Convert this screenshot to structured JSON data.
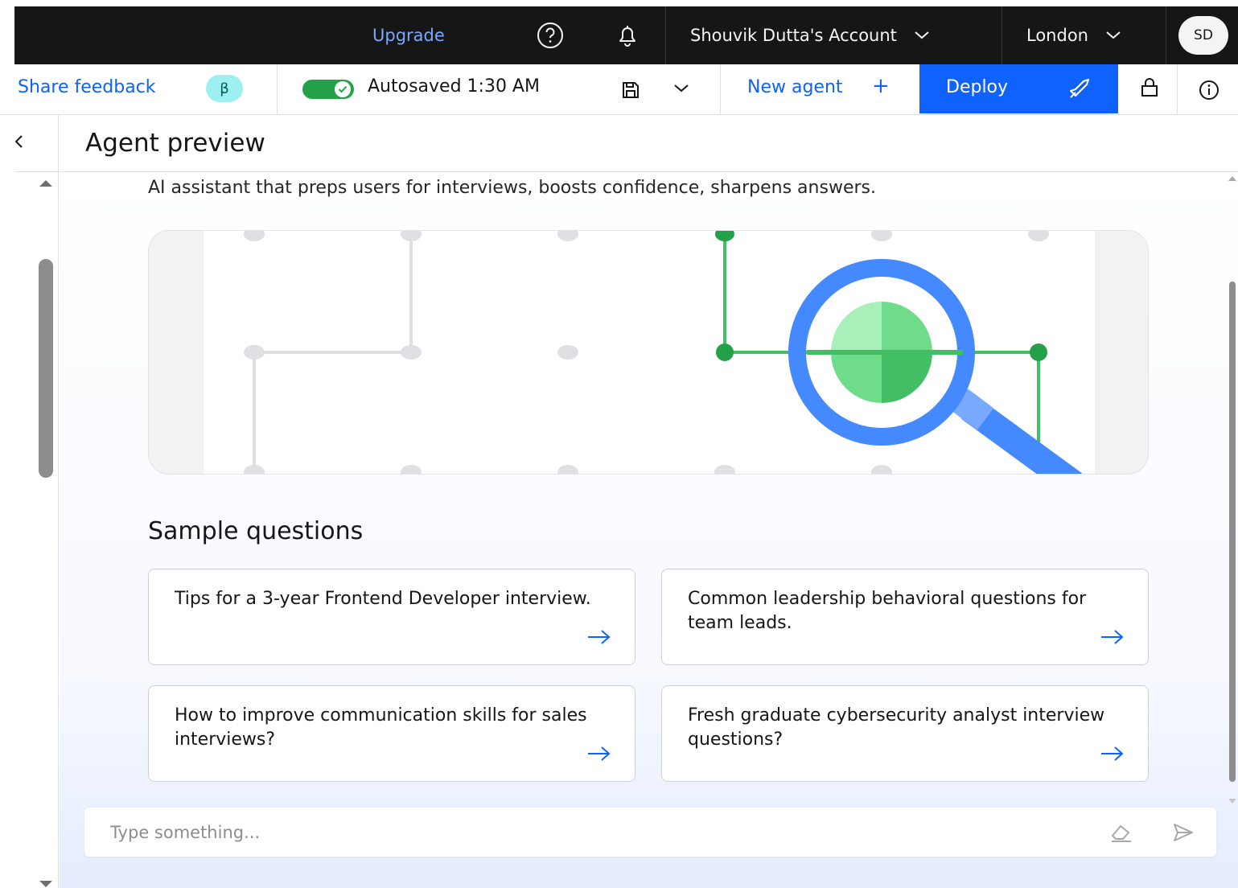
{
  "topbar": {
    "upgrade_label": "Upgrade",
    "account_label": "Shouvik Dutta's Account",
    "region_label": "London",
    "avatar_initials": "SD"
  },
  "toolbar": {
    "share_feedback_label": "Share feedback",
    "beta_badge": "β",
    "autosave_status": "Autosaved 1:30 AM",
    "new_agent_label": "New agent",
    "new_agent_plus": "+",
    "deploy_label": "Deploy"
  },
  "panel": {
    "title": "Agent preview",
    "description": "AI assistant that preps users for interviews, boosts confidence, sharpens answers."
  },
  "sample_questions": {
    "title": "Sample questions",
    "items": [
      {
        "text": "Tips for a 3-year Frontend Developer interview."
      },
      {
        "text": "Common leadership behavioral questions for team leads."
      },
      {
        "text": "How to improve communication skills for sales interviews?"
      },
      {
        "text": "Fresh graduate cybersecurity analyst interview questions?"
      }
    ]
  },
  "chat": {
    "placeholder": "Type something..."
  },
  "icons": {
    "help": "help-icon",
    "notifications": "bell-icon",
    "save": "save-icon",
    "deploy": "rocket-icon",
    "lock": "lock-icon",
    "info": "info-icon",
    "back": "chevron-left-icon",
    "eraser": "eraser-icon",
    "send": "send-icon"
  },
  "colors": {
    "brand_blue": "#0f62fe",
    "success_green": "#24a148",
    "topbar_bg": "#161616",
    "beta_bg": "#9ef0f0"
  }
}
